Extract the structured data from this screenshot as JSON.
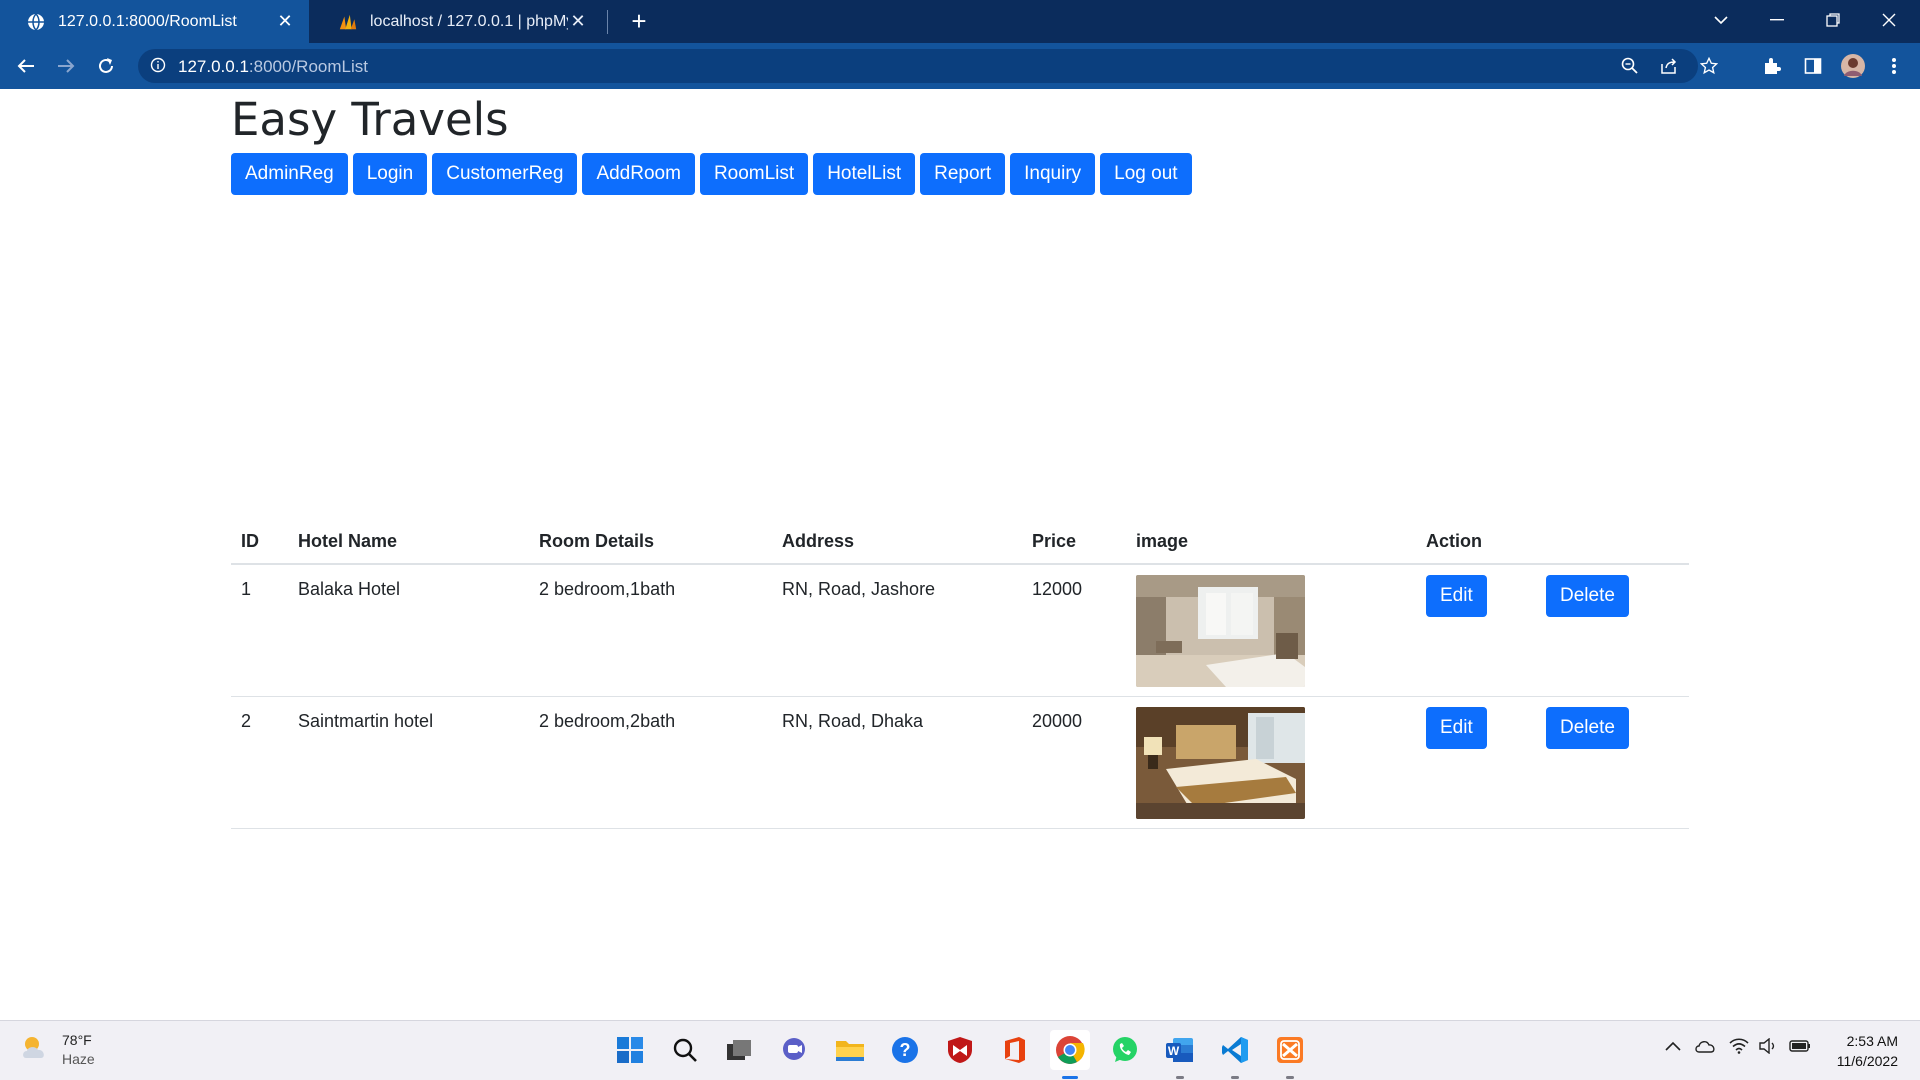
{
  "browser": {
    "tabs": [
      {
        "title": "127.0.0.1:8000/RoomList",
        "active": true
      },
      {
        "title": "localhost / 127.0.0.1 | phpMyAdmin",
        "active": false
      }
    ],
    "url_host": "127.0.0.1",
    "url_path": ":8000/RoomList"
  },
  "site": {
    "title": "Easy Travels",
    "nav": [
      "AdminReg",
      "Login",
      "CustomerReg",
      "AddRoom",
      "RoomList",
      "HotelList",
      "Report",
      "Inquiry",
      "Log out"
    ]
  },
  "table": {
    "headers": {
      "id": "ID",
      "hotel": "Hotel Name",
      "details": "Room Details",
      "address": "Address",
      "price": "Price",
      "image": "image",
      "action": "Action"
    },
    "rows": [
      {
        "id": "1",
        "hotel": "Balaka Hotel",
        "details": "2 bedroom,1bath",
        "address": "RN, Road, Jashore",
        "price": "12000",
        "edit": "Edit",
        "delete": "Delete"
      },
      {
        "id": "2",
        "hotel": "Saintmartin hotel",
        "details": "2 bedroom,2bath",
        "address": "RN, Road, Dhaka",
        "price": "20000",
        "edit": "Edit",
        "delete": "Delete"
      }
    ]
  },
  "taskbar": {
    "weather_temp": "78°F",
    "weather_desc": "Haze",
    "time": "2:53 AM",
    "date": "11/6/2022",
    "apps": [
      "start-icon",
      "search-icon",
      "task-view-icon",
      "chat-icon",
      "file-explorer-icon",
      "help-icon",
      "mcafee-icon",
      "office-icon",
      "chrome-icon",
      "whatsapp-icon",
      "word-icon",
      "vscode-icon",
      "xampp-icon"
    ]
  },
  "colors": {
    "primary": "#0d6efd",
    "chrome_dark": "#0b2c5c",
    "chrome_toolbar": "#13549c"
  }
}
